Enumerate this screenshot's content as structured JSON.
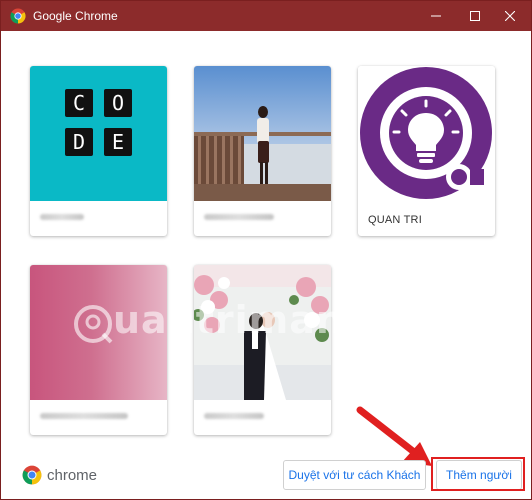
{
  "window": {
    "title": "Google Chrome"
  },
  "profiles": [
    {
      "name": "",
      "blurred": true,
      "image": "code-logo"
    },
    {
      "name": "",
      "blurred": true,
      "image": "girl-photo"
    },
    {
      "name": "QUAN TRI",
      "blurred": false,
      "image": "lightbulb-avatar"
    },
    {
      "name": "",
      "blurred": true,
      "image": "pink-gradient"
    },
    {
      "name": "",
      "blurred": true,
      "image": "wedding-photo"
    }
  ],
  "code_tiles": [
    "C",
    "O",
    "D",
    "E"
  ],
  "watermark": {
    "text": "uantrimang"
  },
  "footer": {
    "brand": "chrome",
    "guest_button": "Duyệt với tư cách Khách",
    "add_button": "Thêm người"
  },
  "colors": {
    "titlebar": "#8c2b2b",
    "code_bg": "#0ab9c6",
    "avatar_purple": "#6a2a86",
    "accent": "#1a73e8",
    "highlight": "#e02020"
  },
  "icons": [
    "chrome-icon",
    "minimize-icon",
    "maximize-icon",
    "close-icon",
    "lightbulb-icon",
    "arrow-annotation-icon"
  ]
}
